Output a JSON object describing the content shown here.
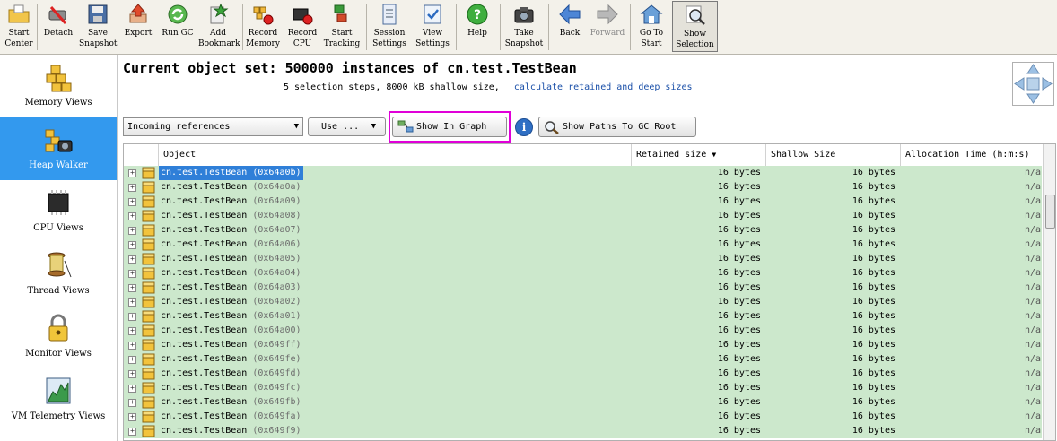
{
  "toolbar": {
    "buttons": [
      {
        "label1": "Start",
        "label2": "Center",
        "icon": "folder-open-icon"
      },
      {
        "label1": "Detach",
        "label2": "",
        "icon": "detach-icon"
      },
      {
        "label1": "Save",
        "label2": "Snapshot",
        "icon": "save-icon"
      },
      {
        "label1": "Export",
        "label2": "",
        "icon": "export-icon"
      },
      {
        "label1": "Run GC",
        "label2": "",
        "icon": "recycle-icon"
      },
      {
        "label1": "Add",
        "label2": "Bookmark",
        "icon": "bookmark-icon"
      },
      {
        "label1": "Record",
        "label2": "Memory",
        "icon": "record-memory-icon"
      },
      {
        "label1": "Record",
        "label2": "CPU",
        "icon": "record-cpu-icon"
      },
      {
        "label1": "Start",
        "label2": "Tracking",
        "icon": "tracking-icon"
      },
      {
        "label1": "Session",
        "label2": "Settings",
        "icon": "session-settings-icon"
      },
      {
        "label1": "View",
        "label2": "Settings",
        "icon": "view-settings-icon"
      },
      {
        "label1": "Help",
        "label2": "",
        "icon": "help-icon"
      },
      {
        "label1": "Take",
        "label2": "Snapshot",
        "icon": "camera-icon"
      },
      {
        "label1": "Back",
        "label2": "",
        "icon": "back-arrow-icon"
      },
      {
        "label1": "Forward",
        "label2": "",
        "icon": "forward-arrow-icon"
      },
      {
        "label1": "Go To",
        "label2": "Start",
        "icon": "home-icon"
      },
      {
        "label1": "Show",
        "label2": "Selection",
        "icon": "show-selection-icon"
      }
    ]
  },
  "sidebar": {
    "items": [
      {
        "label": "Memory Views",
        "icon": "memory-views-icon"
      },
      {
        "label": "Heap Walker",
        "icon": "heap-walker-icon"
      },
      {
        "label": "CPU Views",
        "icon": "cpu-chip-icon"
      },
      {
        "label": "Thread Views",
        "icon": "thread-spool-icon"
      },
      {
        "label": "Monitor Views",
        "icon": "lock-icon"
      },
      {
        "label": "VM Telemetry Views",
        "icon": "telemetry-chart-icon"
      }
    ]
  },
  "header": {
    "title": "Current object set: 500000 instances of cn.test.TestBean",
    "summary": "5 selection steps, 8000 kB shallow size,",
    "link": "calculate retained and deep sizes"
  },
  "controls": {
    "view_select": "Incoming references",
    "use_button": "Use ...",
    "show_in_graph": "Show In Graph",
    "info": "i",
    "show_paths": "Show Paths To GC Root"
  },
  "colors": {
    "row_bg": "#cce8cc",
    "selection": "#2f7fd8",
    "highlight_box": "#e000d8",
    "sidebar_active": "#3399ee"
  },
  "table": {
    "columns": [
      "Object",
      "Retained size",
      "Shallow Size",
      "Allocation Time (h:m:s)"
    ],
    "sort_indicator": "▼",
    "rows": [
      {
        "name": "cn.test.TestBean",
        "addr": "(0x64a0b)",
        "retained": "16 bytes",
        "shallow": "16 bytes",
        "alloc": "n/a"
      },
      {
        "name": "cn.test.TestBean",
        "addr": "(0x64a0a)",
        "retained": "16 bytes",
        "shallow": "16 bytes",
        "alloc": "n/a"
      },
      {
        "name": "cn.test.TestBean",
        "addr": "(0x64a09)",
        "retained": "16 bytes",
        "shallow": "16 bytes",
        "alloc": "n/a"
      },
      {
        "name": "cn.test.TestBean",
        "addr": "(0x64a08)",
        "retained": "16 bytes",
        "shallow": "16 bytes",
        "alloc": "n/a"
      },
      {
        "name": "cn.test.TestBean",
        "addr": "(0x64a07)",
        "retained": "16 bytes",
        "shallow": "16 bytes",
        "alloc": "n/a"
      },
      {
        "name": "cn.test.TestBean",
        "addr": "(0x64a06)",
        "retained": "16 bytes",
        "shallow": "16 bytes",
        "alloc": "n/a"
      },
      {
        "name": "cn.test.TestBean",
        "addr": "(0x64a05)",
        "retained": "16 bytes",
        "shallow": "16 bytes",
        "alloc": "n/a"
      },
      {
        "name": "cn.test.TestBean",
        "addr": "(0x64a04)",
        "retained": "16 bytes",
        "shallow": "16 bytes",
        "alloc": "n/a"
      },
      {
        "name": "cn.test.TestBean",
        "addr": "(0x64a03)",
        "retained": "16 bytes",
        "shallow": "16 bytes",
        "alloc": "n/a"
      },
      {
        "name": "cn.test.TestBean",
        "addr": "(0x64a02)",
        "retained": "16 bytes",
        "shallow": "16 bytes",
        "alloc": "n/a"
      },
      {
        "name": "cn.test.TestBean",
        "addr": "(0x64a01)",
        "retained": "16 bytes",
        "shallow": "16 bytes",
        "alloc": "n/a"
      },
      {
        "name": "cn.test.TestBean",
        "addr": "(0x64a00)",
        "retained": "16 bytes",
        "shallow": "16 bytes",
        "alloc": "n/a"
      },
      {
        "name": "cn.test.TestBean",
        "addr": "(0x649ff)",
        "retained": "16 bytes",
        "shallow": "16 bytes",
        "alloc": "n/a"
      },
      {
        "name": "cn.test.TestBean",
        "addr": "(0x649fe)",
        "retained": "16 bytes",
        "shallow": "16 bytes",
        "alloc": "n/a"
      },
      {
        "name": "cn.test.TestBean",
        "addr": "(0x649fd)",
        "retained": "16 bytes",
        "shallow": "16 bytes",
        "alloc": "n/a"
      },
      {
        "name": "cn.test.TestBean",
        "addr": "(0x649fc)",
        "retained": "16 bytes",
        "shallow": "16 bytes",
        "alloc": "n/a"
      },
      {
        "name": "cn.test.TestBean",
        "addr": "(0x649fb)",
        "retained": "16 bytes",
        "shallow": "16 bytes",
        "alloc": "n/a"
      },
      {
        "name": "cn.test.TestBean",
        "addr": "(0x649fa)",
        "retained": "16 bytes",
        "shallow": "16 bytes",
        "alloc": "n/a"
      },
      {
        "name": "cn.test.TestBean",
        "addr": "(0x649f9)",
        "retained": "16 bytes",
        "shallow": "16 bytes",
        "alloc": "n/a"
      }
    ]
  }
}
